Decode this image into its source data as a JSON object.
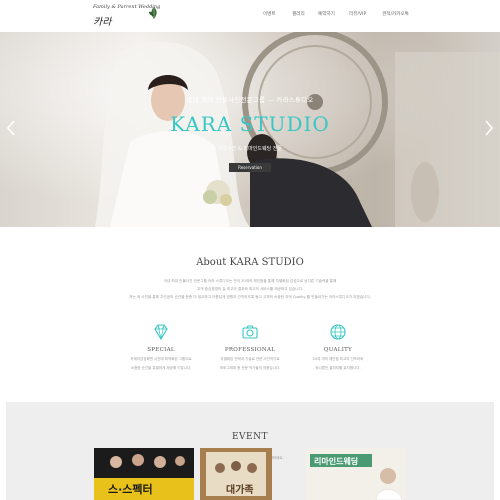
{
  "header": {
    "logo_tagline": "Family & Parrent Wedding",
    "logo_name": "카라",
    "nav": [
      "이벤트",
      "갤러리",
      "예약하기",
      "리뷰/VIP",
      "견적/카카오톡"
    ]
  },
  "hero": {
    "kicker": "국내 최대 인물사진전문그룹 — 카라스튜디오",
    "title": "KARA STUDIO",
    "subtitle": "가족사진 & 리마인드웨딩 전문",
    "button_label": "Reservation"
  },
  "about": {
    "title": "About KARA STUDIO",
    "lines": [
      "국내 최대 인물사진 전문그룹 카라 스튜디오는 전국 20개의 체인점을 통해 차별화된 감성으로 남다른 기술력을 통해",
      "고객 중심경영의 늘 최고의 결과와 최고의 서비스를 제공하고 있습니다.",
      "저는 제 사진을 통해 주인공의 순간을 한층 더 정교하고 아름답게 영원히 간직하도록 돕고 고객의 소중한 추억 Quality 를 만들어가는 카라스튜디오가 되겠습니다."
    ],
    "features": [
      {
        "icon": "diamond-icon",
        "title": "SPECIAL",
        "desc": [
          "카메라감성화면 사진에 최적화된 그룹으로",
          "소중한 순간을 특별하게 제공해 드립니다."
        ]
      },
      {
        "icon": "camera-icon",
        "title": "PROFESSIONAL",
        "desc": [
          "차별화된 전략과 기술로 전문 사진작가로",
          "포토그래퍼 중 전문 작가들의 작품입니다."
        ]
      },
      {
        "icon": "globe-icon",
        "title": "QUALITY",
        "desc": [
          "20여 개의 체인점 최고의 인프라와",
          "하나뿐인 퀄리티를 유지합니다."
        ]
      }
    ]
  },
  "event": {
    "title": "EVENT",
    "subtitle": "카라스튜디오의 다양한 이벤트와 함께하세요.",
    "cards": [
      {
        "name": "event-card-1",
        "label": "스·스펙터"
      },
      {
        "name": "event-card-2",
        "label": "대가족"
      },
      {
        "name": "event-card-3",
        "label": "리마인드웨딩"
      }
    ]
  },
  "colors": {
    "accent": "#38c7c4",
    "button": "#3a3a3a",
    "event_bg": "#eeeeee",
    "leaf": "#3e6b3a"
  }
}
